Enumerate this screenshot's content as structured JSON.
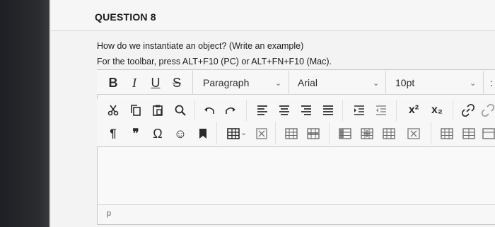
{
  "question": {
    "title": "QUESTION 8",
    "text": "How do we instantiate an object? (Write an example)",
    "hint": "For the toolbar, press ALT+F10 (PC) or ALT+FN+F10 (Mac)."
  },
  "toolbar": {
    "bold": "B",
    "italic": "I",
    "underline": "U",
    "strikethrough": "S",
    "block_format": "Paragraph",
    "font_family": "Arial",
    "font_size": "10pt",
    "superscript": "x²",
    "subscript": "x₂",
    "pilcrow": "¶",
    "blockquote": "❞",
    "omega": "Ω",
    "emoji": "☺"
  },
  "path_bar": {
    "element": "p"
  },
  "colors": {
    "text": "#2b2b2b",
    "border": "#c8c8c8",
    "background": "#f3f3f3"
  }
}
